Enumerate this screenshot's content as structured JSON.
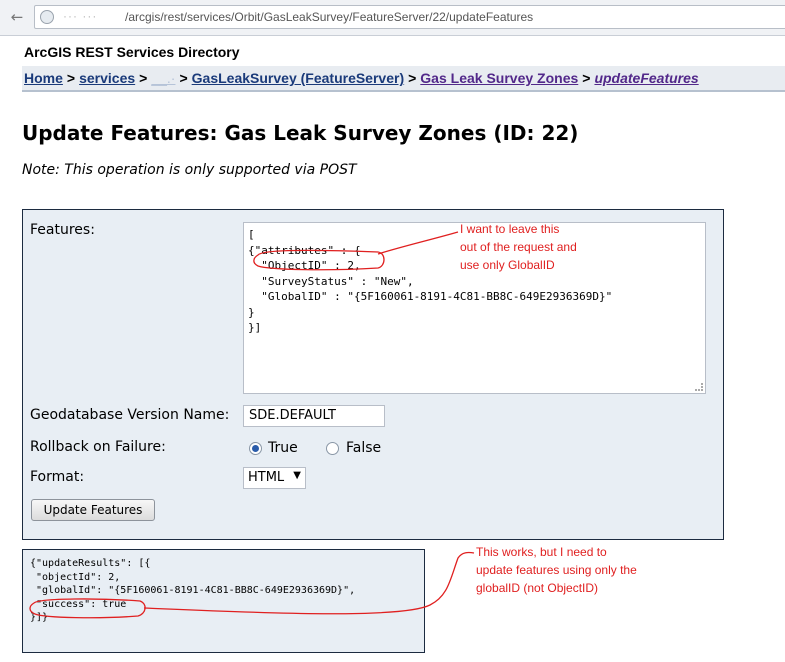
{
  "browser": {
    "url_host": "··· ···",
    "url_path": "/arcgis/rest/services/Orbit/GasLeakSurvey/FeatureServer/22/updateFeatures"
  },
  "header": {
    "directory_title": "ArcGIS REST Services Directory",
    "breadcrumbs": {
      "home": "Home",
      "services": "services",
      "folder": "__.·",
      "feature_server": "GasLeakSurvey (FeatureServer)",
      "layer": "Gas Leak Survey Zones",
      "operation": "updateFeatures",
      "separator": ">"
    }
  },
  "main": {
    "title": "Update Features: Gas Leak Survey Zones (ID: 22)",
    "note": "Note: This operation is only supported via POST",
    "form": {
      "features_label": "Features:",
      "features_value": "[\n{\"attributes\" : {\n  \"ObjectID\" : 2,\n  \"SurveyStatus\" : \"New\",\n  \"GlobalID\" : \"{5F160061-8191-4C81-BB8C-649E2936369D}\"\n}\n}]",
      "gdb_version_label": "Geodatabase Version Name:",
      "gdb_version_value": "SDE.DEFAULT",
      "rollback_label": "Rollback on Failure:",
      "rollback_true": "True",
      "rollback_false": "False",
      "rollback_selected": "True",
      "format_label": "Format:",
      "format_value": "HTML",
      "submit_label": "Update Features"
    },
    "result": "{\"updateResults\": [{\n \"objectId\": 2,\n \"globalId\": \"{5F160061-8191-4C81-BB8C-649E2936369D}\",\n \"success\": true\n}]}"
  },
  "annotations": {
    "top": "I want to leave this\nout of the request and\nuse only GlobalID",
    "bottom": "This works, but I need to\nupdate features using only the\nglobalID (not ObjectID)",
    "color": "#e02020"
  }
}
